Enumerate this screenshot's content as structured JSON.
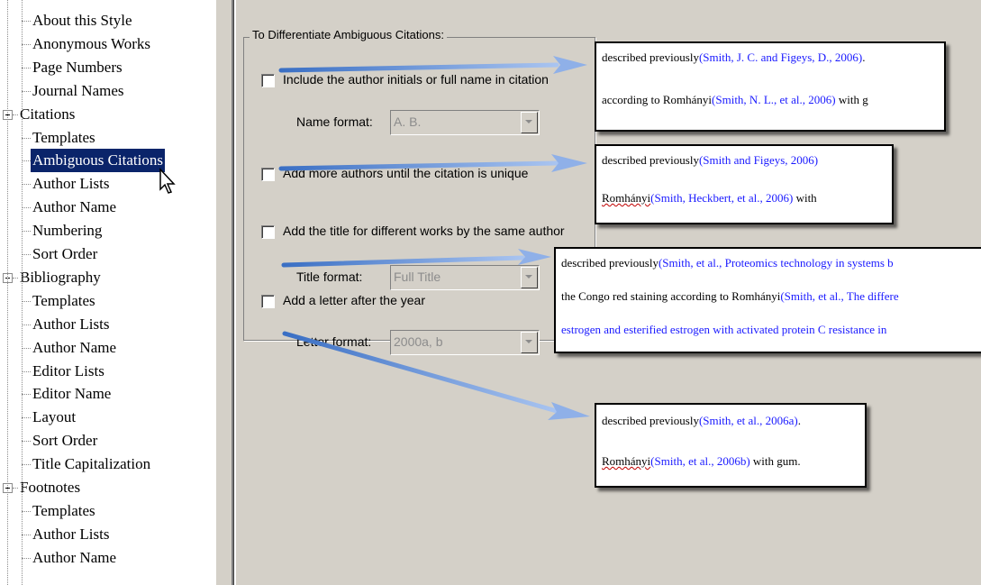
{
  "tree": {
    "items": [
      {
        "label": "About this Style",
        "level": 1
      },
      {
        "label": "Anonymous Works",
        "level": 1
      },
      {
        "label": "Page Numbers",
        "level": 1
      },
      {
        "label": "Journal Names",
        "level": 1
      },
      {
        "label": "Citations",
        "level": 0,
        "expanded": true
      },
      {
        "label": "Templates",
        "level": 1
      },
      {
        "label": "Ambiguous Citations",
        "level": 1,
        "selected": true
      },
      {
        "label": "Author Lists",
        "level": 1
      },
      {
        "label": "Author Name",
        "level": 1
      },
      {
        "label": "Numbering",
        "level": 1
      },
      {
        "label": "Sort Order",
        "level": 1
      },
      {
        "label": "Bibliography",
        "level": 0,
        "expanded": true
      },
      {
        "label": "Templates",
        "level": 1
      },
      {
        "label": "Author Lists",
        "level": 1
      },
      {
        "label": "Author Name",
        "level": 1
      },
      {
        "label": "Editor Lists",
        "level": 1
      },
      {
        "label": "Editor Name",
        "level": 1
      },
      {
        "label": "Layout",
        "level": 1
      },
      {
        "label": "Sort Order",
        "level": 1
      },
      {
        "label": "Title Capitalization",
        "level": 1
      },
      {
        "label": "Footnotes",
        "level": 0,
        "expanded": true
      },
      {
        "label": "Templates",
        "level": 1
      },
      {
        "label": "Author Lists",
        "level": 1
      },
      {
        "label": "Author Name",
        "level": 1
      }
    ]
  },
  "options": {
    "group_title": "To Differentiate Ambiguous Citations:",
    "include_initials": {
      "label": "Include the author initials or full name in citation",
      "checked": false
    },
    "name_format": {
      "label": "Name format:",
      "value": "A. B."
    },
    "more_authors": {
      "label": "Add more authors until the citation is unique",
      "checked": false
    },
    "add_title": {
      "label": "Add the title for different works by the same author",
      "checked": false
    },
    "title_format": {
      "label": "Title format:",
      "value": "Full Title"
    },
    "add_letter": {
      "label": "Add a letter after the year",
      "checked": false
    },
    "letter_format": {
      "label": "Letter format:",
      "value": "2000a, b"
    }
  },
  "examples": {
    "initials": {
      "line1_pre": "described previously",
      "line1_cite": "(Smith, J. C. and Figeys, D., 2006)",
      "line1_post": ".",
      "line2_pre": "according to Romhányi",
      "line2_cite": "(Smith, N. L., et al., 2006)",
      "line2_post": " with g"
    },
    "authors": {
      "line1_pre": "described previously",
      "line1_cite": "(Smith and Figeys, 2006)",
      "line2_pre": "Romhányi",
      "line2_cite": "(Smith, Heckbert, et al., 2006)",
      "line2_post": " with"
    },
    "title": {
      "line1_pre": "described previously",
      "line1_cite": "(Smith, et al., Proteomics technology in systems b",
      "line2_pre": "the Congo red staining according to Romhányi",
      "line2_cite": "(Smith, et al., The differe",
      "line3_cite": "estrogen and esterified estrogen with activated protein C resistance in"
    },
    "letter": {
      "line1_pre": "described previously",
      "line1_cite": "(Smith, et al., 2006a)",
      "line1_post": ".",
      "line2_pre": "Romhányi",
      "line2_cite": "(Smith, et al., 2006b)",
      "line2_post": " with gum."
    }
  },
  "colors": {
    "selection": "#0a246a",
    "panel": "#d4d0c8",
    "citation": "#1a1aff",
    "arrow": "#5b8fd6"
  }
}
